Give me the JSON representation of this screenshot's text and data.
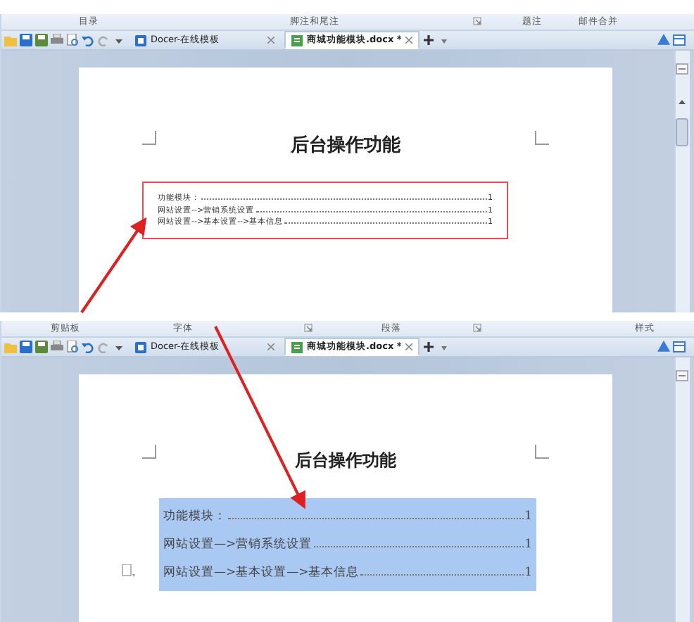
{
  "panels": [
    {
      "ribbon_items": [
        {
          "kind": "label",
          "label": "目录"
        },
        {
          "kind": "label",
          "label": "脚注和尾注"
        },
        {
          "kind": "launcher"
        },
        {
          "kind": "label",
          "label": "题注"
        },
        {
          "kind": "label",
          "label": "邮件合并"
        }
      ],
      "tabs": [
        {
          "label": "Docer-在线模板",
          "selected": false
        },
        {
          "label": "商城功能模块.docx *",
          "selected": true
        }
      ],
      "document": {
        "title": "后台操作功能",
        "toc_selected": false,
        "toc": [
          {
            "text": "功能模块：",
            "page": "1"
          },
          {
            "text": "网站设置-->营销系统设置",
            "page": "1"
          },
          {
            "text": "网站设置-->基本设置-->基本信息",
            "page": "1"
          }
        ]
      }
    },
    {
      "ribbon_items": [
        {
          "kind": "label",
          "label": "剪贴板"
        },
        {
          "kind": "label",
          "label": "字体"
        },
        {
          "kind": "launcher"
        },
        {
          "kind": "label",
          "label": "段落"
        },
        {
          "kind": "launcher"
        },
        {
          "kind": "label",
          "label": "样式"
        }
      ],
      "tabs": [
        {
          "label": "Docer-在线模板",
          "selected": false
        },
        {
          "label": "商城功能模块.docx *",
          "selected": true
        }
      ],
      "document": {
        "title": "后台操作功能",
        "toc_selected": true,
        "toc": [
          {
            "text": "功能模块：",
            "page": "1"
          },
          {
            "text": "网站设置—>营销系统设置",
            "page": "1"
          },
          {
            "text": "网站设置—>基本设置—>基本信息",
            "page": "1"
          }
        ]
      }
    }
  ]
}
